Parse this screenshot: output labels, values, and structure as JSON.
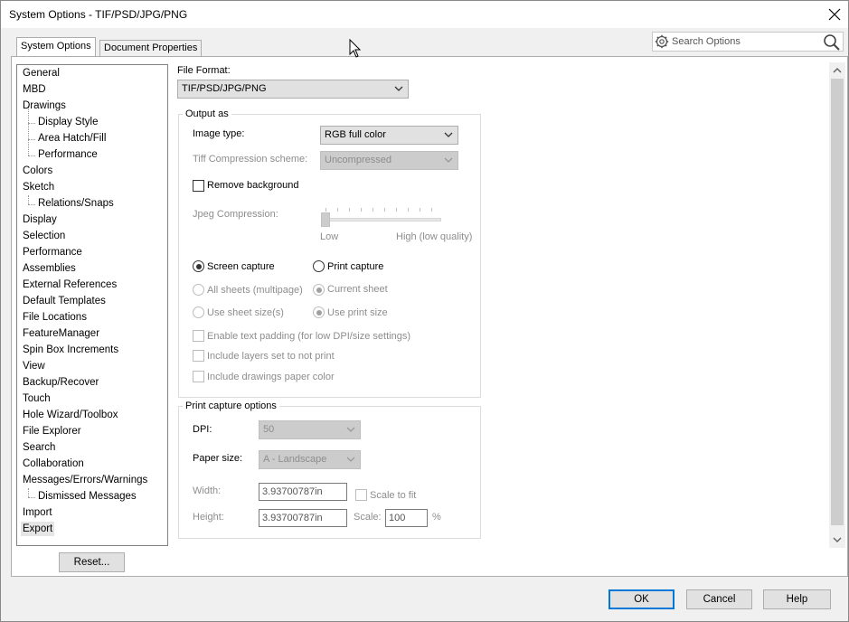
{
  "window": {
    "title": "System Options - TIF/PSD/JPG/PNG",
    "close_icon": "close-icon"
  },
  "tabs": [
    {
      "label": "System Options",
      "active": true
    },
    {
      "label": "Document Properties",
      "active": false
    }
  ],
  "search": {
    "placeholder": "Search Options",
    "icon_left": "gear-icon",
    "icon_right": "search-icon"
  },
  "tree": {
    "items": [
      {
        "label": "General",
        "level": 0
      },
      {
        "label": "MBD",
        "level": 0
      },
      {
        "label": "Drawings",
        "level": 0
      },
      {
        "label": "Display Style",
        "level": 1
      },
      {
        "label": "Area Hatch/Fill",
        "level": 1
      },
      {
        "label": "Performance",
        "level": 1
      },
      {
        "label": "Colors",
        "level": 0
      },
      {
        "label": "Sketch",
        "level": 0
      },
      {
        "label": "Relations/Snaps",
        "level": 1
      },
      {
        "label": "Display",
        "level": 0
      },
      {
        "label": "Selection",
        "level": 0
      },
      {
        "label": "Performance",
        "level": 0
      },
      {
        "label": "Assemblies",
        "level": 0
      },
      {
        "label": "External References",
        "level": 0
      },
      {
        "label": "Default Templates",
        "level": 0
      },
      {
        "label": "File Locations",
        "level": 0
      },
      {
        "label": "FeatureManager",
        "level": 0
      },
      {
        "label": "Spin Box Increments",
        "level": 0
      },
      {
        "label": "View",
        "level": 0
      },
      {
        "label": "Backup/Recover",
        "level": 0
      },
      {
        "label": "Touch",
        "level": 0
      },
      {
        "label": "Hole Wizard/Toolbox",
        "level": 0
      },
      {
        "label": "File Explorer",
        "level": 0
      },
      {
        "label": "Search",
        "level": 0
      },
      {
        "label": "Collaboration",
        "level": 0
      },
      {
        "label": "Messages/Errors/Warnings",
        "level": 0
      },
      {
        "label": "Dismissed Messages",
        "level": 1
      },
      {
        "label": "Import",
        "level": 0
      },
      {
        "label": "Export",
        "level": 0,
        "selected": true
      }
    ]
  },
  "reset_button": "Reset...",
  "file_format": {
    "label": "File Format:",
    "value": "TIF/PSD/JPG/PNG"
  },
  "output_as": {
    "title": "Output as",
    "image_type_label": "Image type:",
    "image_type_value": "RGB full color",
    "tiff_label": "Tiff Compression scheme:",
    "tiff_value": "Uncompressed",
    "remove_background_label": "Remove background",
    "remove_background_checked": false,
    "jpeg_label": "Jpeg Compression:",
    "jpeg_low": "Low",
    "jpeg_high": "High (low quality)",
    "jpeg_level": 0,
    "screen_capture_label": "Screen capture",
    "screen_capture_selected": true,
    "print_capture_label": "Print capture",
    "all_sheets_label": "All sheets (multipage)",
    "current_sheet_label": "Current sheet",
    "use_sheet_size_label": "Use sheet size(s)",
    "use_print_size_label": "Use print size",
    "enable_padding_label": "Enable text padding (for low DPI/size settings)",
    "include_layers_label": "Include layers set to not print",
    "include_paper_color_label": "Include drawings paper color"
  },
  "print_capture": {
    "title": "Print capture options",
    "dpi_label": "DPI:",
    "dpi_value": "50",
    "paper_label": "Paper size:",
    "paper_value": "A - Landscape",
    "width_label": "Width:",
    "width_value": "3.93700787in",
    "height_label": "Height:",
    "height_value": "3.93700787in",
    "scale_to_fit_label": "Scale to fit",
    "scale_label": "Scale:",
    "scale_value": "100",
    "percent": "%"
  },
  "footer": {
    "ok": "OK",
    "cancel": "Cancel",
    "help": "Help"
  }
}
